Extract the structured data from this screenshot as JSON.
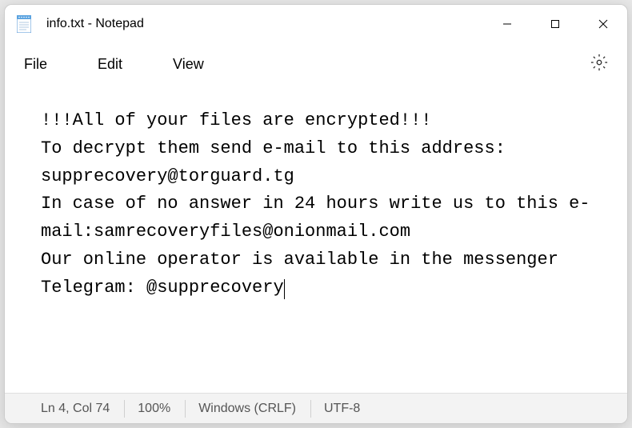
{
  "titlebar": {
    "filename": "info.txt",
    "app_name": "Notepad",
    "title": "info.txt - Notepad"
  },
  "menubar": {
    "file": "File",
    "edit": "Edit",
    "view": "View"
  },
  "content": {
    "line1": "!!!All of your files are encrypted!!!",
    "line2": "To decrypt them send e-mail to this address: supprecovery@torguard.tg",
    "line3": "In case of no answer in 24 hours write us to this e-mail:samrecoveryfiles@onionmail.com",
    "line4": "Our online operator is available in the messenger Telegram: @supprecovery"
  },
  "statusbar": {
    "position": "Ln 4, Col 74",
    "zoom": "100%",
    "line_ending": "Windows (CRLF)",
    "encoding": "UTF-8"
  }
}
